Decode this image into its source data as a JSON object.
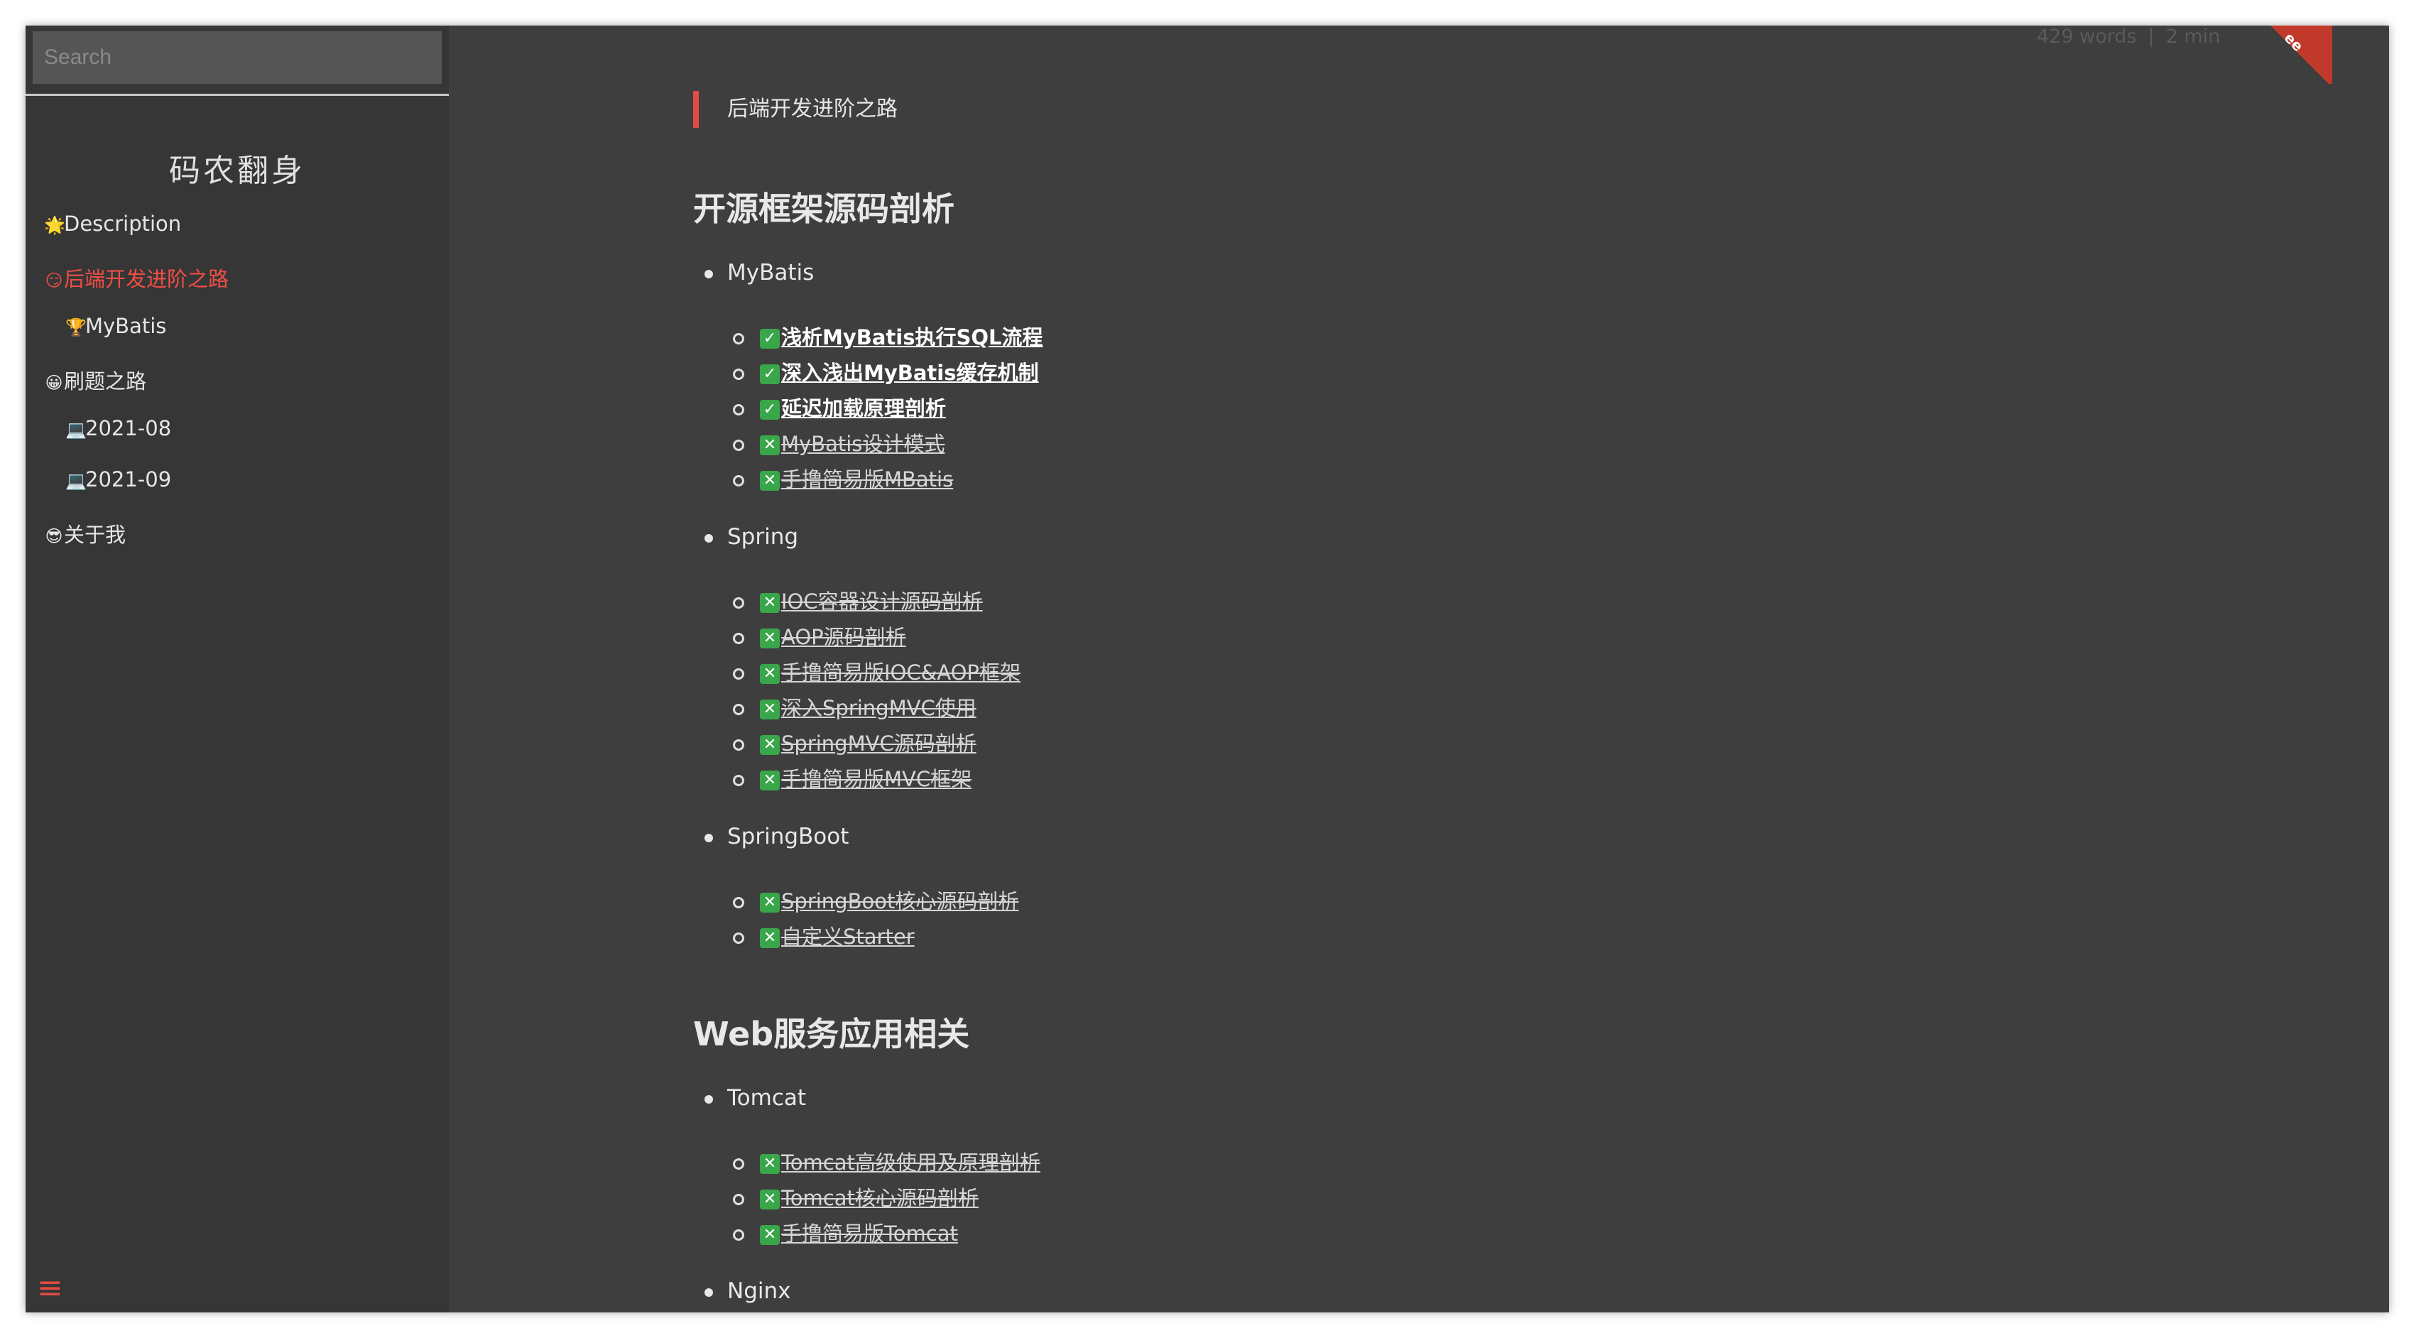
{
  "search": {
    "placeholder": "Search"
  },
  "site_title": "码农翻身",
  "nav": {
    "items": [
      {
        "emoji": "🌟",
        "label": "Description"
      },
      {
        "emoji": "😏",
        "label": "后端开发进阶之路",
        "active": true
      },
      {
        "emoji": "🏆",
        "label": "MyBatis"
      },
      {
        "emoji": "😀",
        "label": "刷题之路"
      },
      {
        "emoji": "💻",
        "label": "2021-08"
      },
      {
        "emoji": "💻",
        "label": "2021-09"
      },
      {
        "emoji": "😎",
        "label": "关于我"
      }
    ],
    "menu_icon": "≡"
  },
  "meta": {
    "words": "429 words",
    "separator": "|",
    "read_time": "2 min"
  },
  "ribbon": {
    "text": "ee"
  },
  "page": {
    "quote": "后端开发进阶之路",
    "sections": [
      {
        "heading": "开源框架源码剖析",
        "groups": [
          {
            "name": "MyBatis",
            "articles": [
              {
                "status": "done",
                "mark": "✓",
                "title": "浅析MyBatis执行SQL流程"
              },
              {
                "status": "done",
                "mark": "✓",
                "title": "深入浅出MyBatis缓存机制"
              },
              {
                "status": "done",
                "mark": "✓",
                "title": "延迟加载原理剖析"
              },
              {
                "status": "todo",
                "mark": "✕",
                "title": "MyBatis设计模式"
              },
              {
                "status": "todo",
                "mark": "✕",
                "title": "手撸简易版MBatis"
              }
            ]
          },
          {
            "name": "Spring",
            "articles": [
              {
                "status": "todo",
                "mark": "✕",
                "title": "IOC容器设计源码剖析"
              },
              {
                "status": "todo",
                "mark": "✕",
                "title": "AOP源码剖析"
              },
              {
                "status": "todo",
                "mark": "✕",
                "title": "手撸简易版IOC&AOP框架"
              },
              {
                "status": "todo",
                "mark": "✕",
                "title": "深入SpringMVC使用"
              },
              {
                "status": "todo",
                "mark": "✕",
                "title": "SpringMVC源码剖析"
              },
              {
                "status": "todo",
                "mark": "✕",
                "title": "手撸简易版MVC框架"
              }
            ]
          },
          {
            "name": "SpringBoot",
            "articles": [
              {
                "status": "todo",
                "mark": "✕",
                "title": "SpringBoot核心源码剖析"
              },
              {
                "status": "todo",
                "mark": "✕",
                "title": "自定义Starter"
              }
            ]
          }
        ]
      },
      {
        "heading": "Web服务应用相关",
        "groups": [
          {
            "name": "Tomcat",
            "articles": [
              {
                "status": "todo",
                "mark": "✕",
                "title": "Tomcat高级使用及原理剖析"
              },
              {
                "status": "todo",
                "mark": "✕",
                "title": "Tomcat核心源码剖析"
              },
              {
                "status": "todo",
                "mark": "✕",
                "title": "手撸简易版Tomcat"
              }
            ]
          },
          {
            "name": "Nginx",
            "articles": []
          }
        ]
      }
    ]
  }
}
